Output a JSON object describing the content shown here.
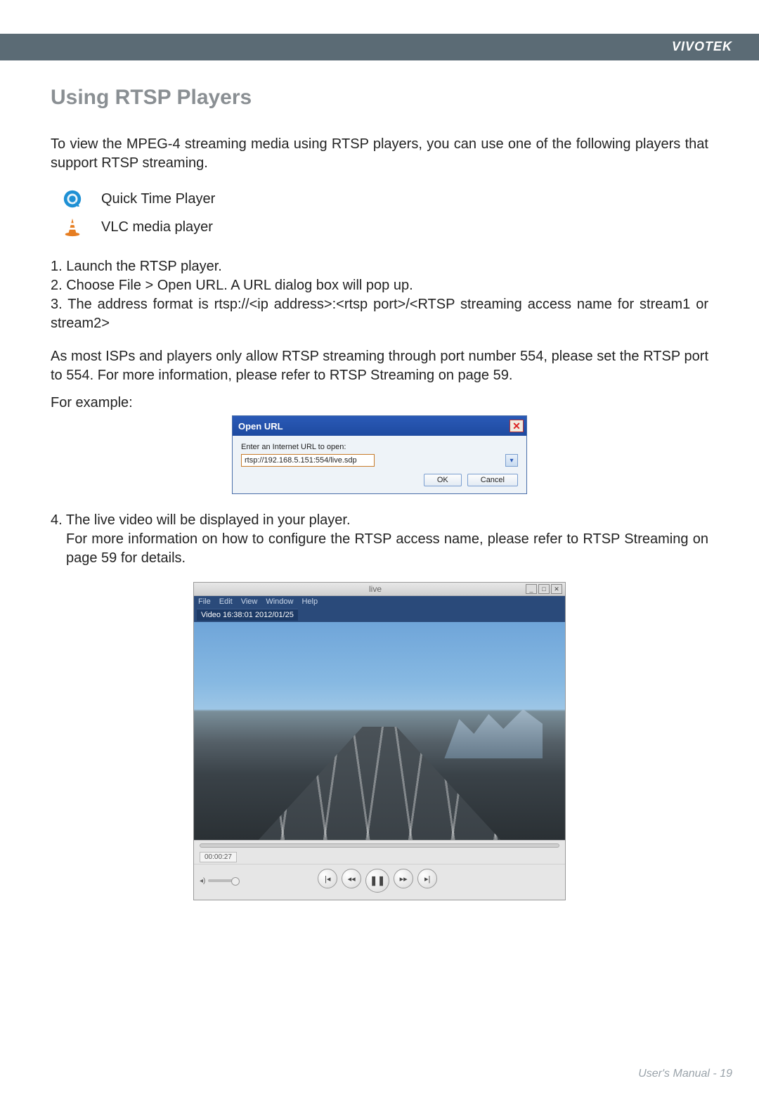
{
  "header": {
    "brand": "VIVOTEK"
  },
  "section": {
    "title": "Using RTSP Players"
  },
  "intro": "To view the MPEG-4 streaming media using RTSP players, you can use one of the following players that support RTSP streaming.",
  "players": [
    {
      "icon": "quicktime",
      "label": "Quick Time Player"
    },
    {
      "icon": "vlc",
      "label": "VLC media player"
    }
  ],
  "steps": {
    "s1": "1. Launch the RTSP player.",
    "s2": "2. Choose File > Open URL. A URL dialog box will pop up.",
    "s3": "3. The address format is rtsp://<ip address>:<rtsp port>/<RTSP streaming access name for stream1 or stream2>"
  },
  "note": "As most ISPs and players only allow RTSP streaming through port number 554, please set the RTSP port to 554. For more information, please refer to RTSP Streaming on page 59.",
  "example_label": "For example:",
  "dialog": {
    "title": "Open URL",
    "label": "Enter an Internet URL to open:",
    "url": "rtsp://192.168.5.151:554/live.sdp",
    "ok": "OK",
    "cancel": "Cancel"
  },
  "step4": {
    "line1": "4. The live video will be displayed in your player.",
    "line2": "For more information on how to configure the RTSP access name, please refer to RTSP Streaming on page 59 for details."
  },
  "media_player": {
    "title": "live",
    "menus": [
      "File",
      "Edit",
      "View",
      "Window",
      "Help"
    ],
    "timestamp": "Video 16:38:01 2012/01/25",
    "elapsed": "00:00:27",
    "volume_label": "◂)"
  },
  "footer": {
    "text": "User's Manual - ",
    "page": "19"
  }
}
